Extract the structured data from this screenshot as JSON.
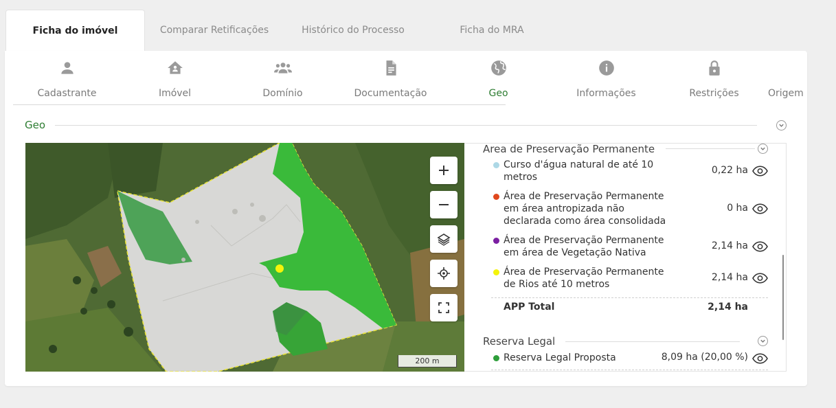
{
  "top_tabs": [
    {
      "label": "Ficha do imóvel",
      "active": true
    },
    {
      "label": "Comparar Retificações",
      "active": false
    },
    {
      "label": "Histórico do Processo",
      "active": false
    },
    {
      "label": "Ficha do MRA",
      "active": false
    }
  ],
  "section_tabs": [
    {
      "label": "Cadastrante",
      "icon": "person-icon"
    },
    {
      "label": "Imóvel",
      "icon": "house-icon"
    },
    {
      "label": "Domínio",
      "icon": "group-icon"
    },
    {
      "label": "Documentação",
      "icon": "document-icon"
    },
    {
      "label": "Geo",
      "icon": "globe-icon",
      "active": true
    },
    {
      "label": "Informações",
      "icon": "info-icon"
    },
    {
      "label": "Restrições",
      "icon": "lock-icon"
    },
    {
      "label": "Origem das",
      "icon": ""
    }
  ],
  "geo": {
    "title": "Geo"
  },
  "map": {
    "scale_label": "200 m",
    "controls": [
      "zoom-in-icon",
      "zoom-out-icon",
      "layers-icon",
      "locate-icon",
      "fullscreen-icon"
    ]
  },
  "app_section": {
    "title": "Area de Preservação Permanente",
    "items": [
      {
        "label": "Curso d'água natural de até 10 metros",
        "value": "0,22 ha",
        "color": "#add8e6"
      },
      {
        "label": "Área de Preservação Permanente em área antropizada não declarada como área consolidada",
        "value": "0 ha",
        "color": "#e0481d"
      },
      {
        "label": "Área de Preservação Permanente em área de Vegetação Nativa",
        "value": "2,14 ha",
        "color": "#7b1fa2"
      },
      {
        "label": "Área de Preservação Permanente de Rios até 10 metros",
        "value": "2,14 ha",
        "color": "#f4f40a"
      }
    ],
    "total_label": "APP Total",
    "total_value": "2,14 ha"
  },
  "reserva_section": {
    "title": "Reserva Legal",
    "items": [
      {
        "label": "Reserva Legal Proposta",
        "value": "8,09 ha (20,00 %)",
        "color": "#2e9e3a"
      }
    ]
  },
  "colors": {
    "accent": "#2e7d32",
    "app_polygon": "#3bb53b",
    "property": "#d9d9d9"
  }
}
